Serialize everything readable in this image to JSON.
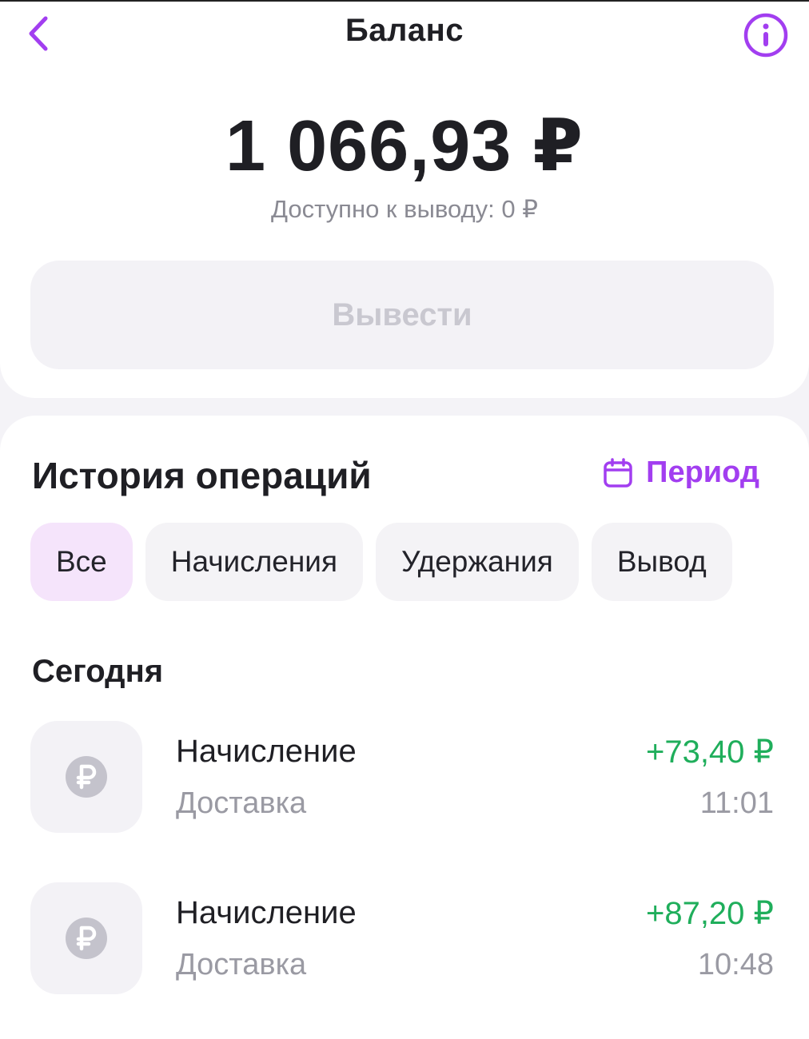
{
  "header": {
    "title": "Баланс"
  },
  "balance": {
    "amount": "1 066,93 ₽",
    "available": "Доступно к выводу: 0 ₽",
    "withdraw_label": "Вывести"
  },
  "history": {
    "title": "История операций",
    "period_label": "Период",
    "filters": [
      {
        "label": "Все",
        "active": true
      },
      {
        "label": "Начисления",
        "active": false
      },
      {
        "label": "Удержания",
        "active": false
      },
      {
        "label": "Вывод",
        "active": false
      }
    ],
    "section_today": "Сегодня",
    "operations": [
      {
        "title": "Начисление",
        "subtitle": "Доставка",
        "amount": "+73,40 ₽",
        "time": "11:01"
      },
      {
        "title": "Начисление",
        "subtitle": "Доставка",
        "amount": "+87,20 ₽",
        "time": "10:48"
      }
    ]
  },
  "colors": {
    "accent": "#a23ef0",
    "positive": "#1fae5b",
    "muted": "#9a9aa3",
    "chip_active": "#f5e4fb"
  },
  "icons": {
    "back": "chevron-left-icon",
    "info": "info-icon",
    "period": "calendar-icon",
    "operation": "ruble-coin-icon"
  }
}
